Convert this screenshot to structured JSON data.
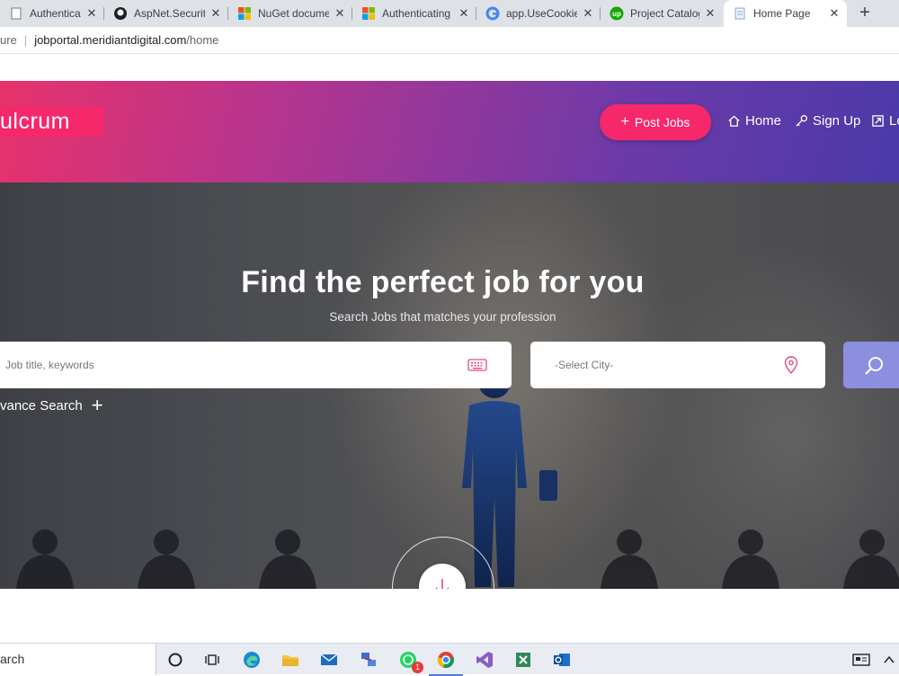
{
  "browser": {
    "tabs": [
      {
        "title": "Authentication | A",
        "icon": "generic-page-icon"
      },
      {
        "title": "AspNet.Security.O",
        "icon": "github-icon"
      },
      {
        "title": "NuGet documenta",
        "icon": "microsoft-icon"
      },
      {
        "title": "Authenticating wi",
        "icon": "microsoft-icon"
      },
      {
        "title": "app.UseCookieAu",
        "icon": "google-icon"
      },
      {
        "title": "Project Catalog | U",
        "icon": "upwork-icon"
      },
      {
        "title": "Home Page",
        "icon": "page-icon",
        "active": true
      }
    ],
    "new_tab": "+",
    "address": {
      "prefix": "ure",
      "host": "jobportal.meridiantdigital.com",
      "path": "/home"
    }
  },
  "header": {
    "logo": "ulcrum",
    "post_jobs": "Post Jobs",
    "nav": {
      "home": "Home",
      "sign_up": "Sign Up",
      "login": "Lo"
    }
  },
  "hero": {
    "title": "Find the perfect job for you",
    "subtitle": "Search Jobs that matches your profession",
    "keyword_placeholder": "Job title, keywords",
    "city_placeholder": "-Select City-",
    "advance_search": "vance Search"
  },
  "taskbar": {
    "search": "arch",
    "whatsapp_badge": "1",
    "apps": [
      "cortana-icon",
      "task-view-icon",
      "edge-icon",
      "file-explorer-icon",
      "mail-icon",
      "network-icon",
      "whatsapp-icon",
      "chrome-icon",
      "visual-studio-icon",
      "excel-like-icon",
      "outlook-icon",
      "news-icon",
      "chevron-up-icon"
    ]
  },
  "colors": {
    "accent": "#f5286b",
    "header_start": "#e8326b",
    "header_end": "#4a3aa8",
    "search_button": "#8c8ee0"
  }
}
